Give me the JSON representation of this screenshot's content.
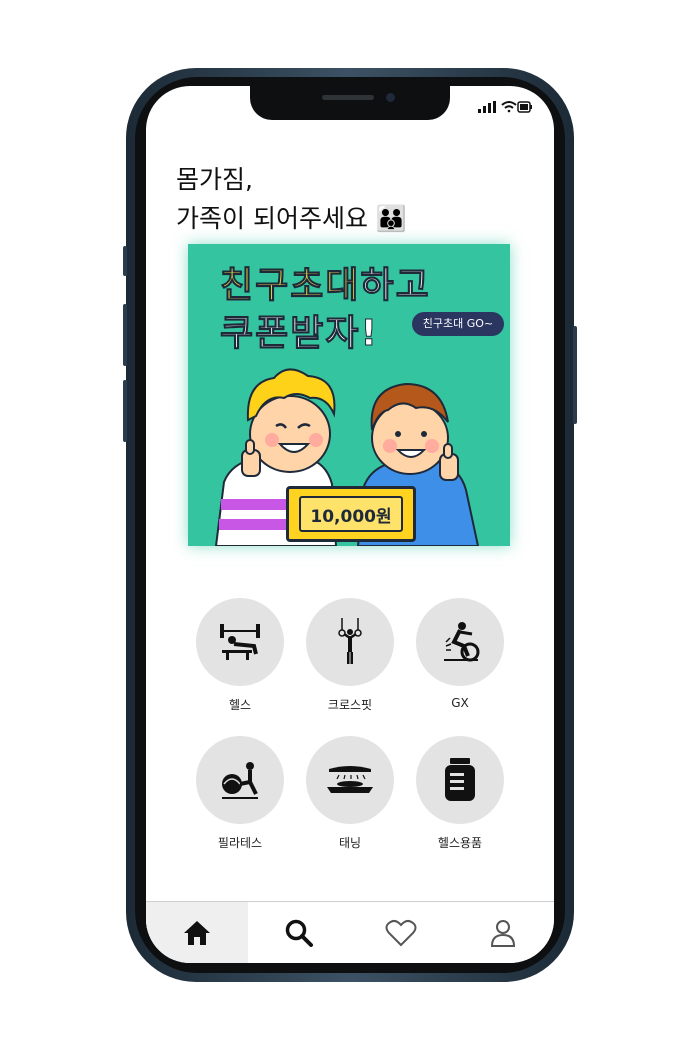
{
  "headline": {
    "line1": "몸가짐,",
    "line2": "가족이 되어주세요",
    "emoji": "👪"
  },
  "banner": {
    "title_hl1": "친구초대",
    "title_rest1": "하고",
    "title_line2": "쿠폰받자!",
    "cta_label": "친구초대 GO~",
    "coupon_amount": "10,000원",
    "accent_color": "#35c4a0",
    "highlight_color": "#ffe94a"
  },
  "categories": [
    {
      "label": "헬스",
      "icon": "bench-press-icon"
    },
    {
      "label": "크로스핏",
      "icon": "rings-icon"
    },
    {
      "label": "GX",
      "icon": "spin-bike-icon"
    },
    {
      "label": "필라테스",
      "icon": "pilates-ball-icon"
    },
    {
      "label": "태닝",
      "icon": "tanning-bed-icon"
    },
    {
      "label": "헬스용품",
      "icon": "supplement-jar-icon"
    }
  ],
  "tabbar": {
    "items": [
      {
        "icon": "home-icon",
        "active": true
      },
      {
        "icon": "search-icon",
        "active": false
      },
      {
        "icon": "heart-icon",
        "active": false
      },
      {
        "icon": "profile-icon",
        "active": false
      }
    ]
  }
}
